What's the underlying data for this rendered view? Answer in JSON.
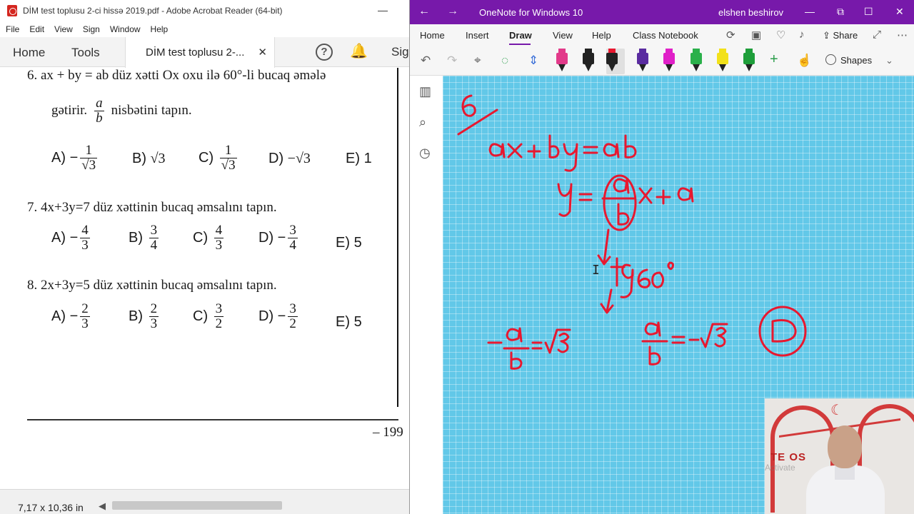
{
  "acrobat": {
    "window_title": "DİM test toplusu 2-ci hissə 2019.pdf - Adobe Acrobat Reader (64-bit)",
    "menu": [
      "File",
      "Edit",
      "View",
      "Sign",
      "Window",
      "Help"
    ],
    "tab_home": "Home",
    "tab_tools": "Tools",
    "doc_tab": "DİM test toplusu 2-...",
    "sign_label": "Sig",
    "page_number": "– 199",
    "status_dimensions": "7,17 x 10,36 in"
  },
  "questions": {
    "q6": {
      "line1": "6.  ax + by = ab  düz xətti Ox oxu ilə 60°-li bucaq əmələ",
      "line2_pre": "gətirir.",
      "line2_frac_num": "a",
      "line2_frac_den": "b",
      "line2_post": "nisbətini tapın.",
      "options": [
        {
          "label": "A)",
          "sign": "−",
          "num": "1",
          "den": "√3"
        },
        {
          "label": "B)",
          "text": "√3"
        },
        {
          "label": "C)",
          "num": "1",
          "den": "√3"
        },
        {
          "label": "D)",
          "text": "−√3"
        },
        {
          "label": "E)",
          "text": "1"
        }
      ]
    },
    "q7": {
      "text": "7. 4x+3y=7 düz xəttinin bucaq əmsalını tapın.",
      "options": [
        {
          "label": "A)",
          "sign": "−",
          "num": "4",
          "den": "3"
        },
        {
          "label": "B)",
          "num": "3",
          "den": "4"
        },
        {
          "label": "C)",
          "num": "4",
          "den": "3"
        },
        {
          "label": "D)",
          "sign": "−",
          "num": "3",
          "den": "4"
        },
        {
          "label": "E)",
          "text": "5"
        }
      ]
    },
    "q8": {
      "text": "8. 2x+3y=5 düz xəttinin bucaq əmsalını tapın.",
      "options": [
        {
          "label": "A)",
          "sign": "−",
          "num": "2",
          "den": "3"
        },
        {
          "label": "B)",
          "num": "2",
          "den": "3"
        },
        {
          "label": "C)",
          "num": "3",
          "den": "2"
        },
        {
          "label": "D)",
          "sign": "−",
          "num": "3",
          "den": "2"
        },
        {
          "label": "E)",
          "text": "5"
        }
      ]
    }
  },
  "onenote": {
    "app_title": "OneNote for Windows 10",
    "user_name": "elshen beshirov",
    "ribbon_tabs": [
      "Home",
      "Insert",
      "Draw",
      "View",
      "Help",
      "Class Notebook"
    ],
    "active_tab": "Draw",
    "share_label": "Share",
    "shapes_label": "Shapes",
    "pen_colors": [
      "#e23a8a",
      "#222222",
      "#e8182f",
      "#5a2ca0",
      "#e020c8",
      "#2ab04a",
      "#f2e11a",
      "#1e9e3a"
    ],
    "ink_color": "#e8182f",
    "canvas_color": "#62c8e8"
  },
  "webcam": {
    "logo_text": "TE  OS",
    "watermark": "Activate"
  }
}
